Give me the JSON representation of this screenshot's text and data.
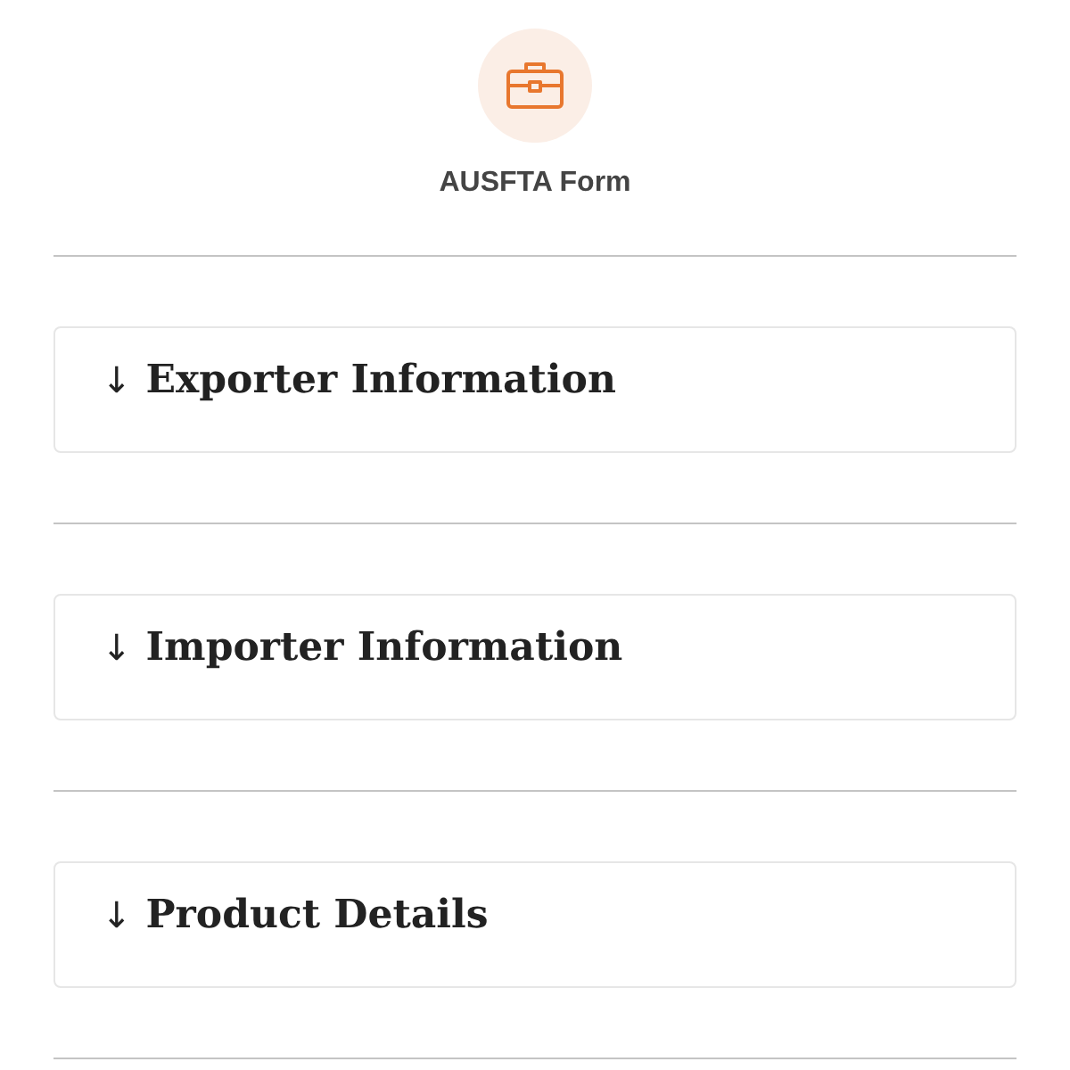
{
  "header": {
    "title": "AUSFTA Form"
  },
  "sections": [
    {
      "marker": "↓",
      "title": "Exporter Information"
    },
    {
      "marker": "↓",
      "title": "Importer Information"
    },
    {
      "marker": "↓",
      "title": "Product Details"
    }
  ]
}
